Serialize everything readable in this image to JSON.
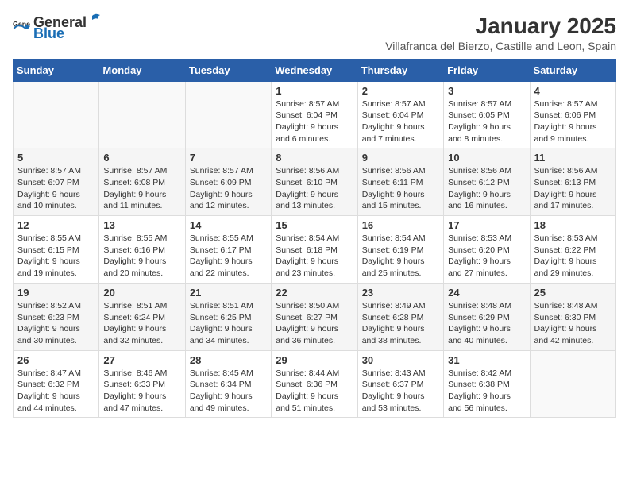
{
  "header": {
    "logo_general": "General",
    "logo_blue": "Blue",
    "month_title": "January 2025",
    "location": "Villafranca del Bierzo, Castille and Leon, Spain"
  },
  "days_of_week": [
    "Sunday",
    "Monday",
    "Tuesday",
    "Wednesday",
    "Thursday",
    "Friday",
    "Saturday"
  ],
  "weeks": [
    {
      "cells": [
        {
          "day": "",
          "content": ""
        },
        {
          "day": "",
          "content": ""
        },
        {
          "day": "",
          "content": ""
        },
        {
          "day": "1",
          "content": "Sunrise: 8:57 AM\nSunset: 6:04 PM\nDaylight: 9 hours and 6 minutes."
        },
        {
          "day": "2",
          "content": "Sunrise: 8:57 AM\nSunset: 6:04 PM\nDaylight: 9 hours and 7 minutes."
        },
        {
          "day": "3",
          "content": "Sunrise: 8:57 AM\nSunset: 6:05 PM\nDaylight: 9 hours and 8 minutes."
        },
        {
          "day": "4",
          "content": "Sunrise: 8:57 AM\nSunset: 6:06 PM\nDaylight: 9 hours and 9 minutes."
        }
      ]
    },
    {
      "cells": [
        {
          "day": "5",
          "content": "Sunrise: 8:57 AM\nSunset: 6:07 PM\nDaylight: 9 hours and 10 minutes."
        },
        {
          "day": "6",
          "content": "Sunrise: 8:57 AM\nSunset: 6:08 PM\nDaylight: 9 hours and 11 minutes."
        },
        {
          "day": "7",
          "content": "Sunrise: 8:57 AM\nSunset: 6:09 PM\nDaylight: 9 hours and 12 minutes."
        },
        {
          "day": "8",
          "content": "Sunrise: 8:56 AM\nSunset: 6:10 PM\nDaylight: 9 hours and 13 minutes."
        },
        {
          "day": "9",
          "content": "Sunrise: 8:56 AM\nSunset: 6:11 PM\nDaylight: 9 hours and 15 minutes."
        },
        {
          "day": "10",
          "content": "Sunrise: 8:56 AM\nSunset: 6:12 PM\nDaylight: 9 hours and 16 minutes."
        },
        {
          "day": "11",
          "content": "Sunrise: 8:56 AM\nSunset: 6:13 PM\nDaylight: 9 hours and 17 minutes."
        }
      ]
    },
    {
      "cells": [
        {
          "day": "12",
          "content": "Sunrise: 8:55 AM\nSunset: 6:15 PM\nDaylight: 9 hours and 19 minutes."
        },
        {
          "day": "13",
          "content": "Sunrise: 8:55 AM\nSunset: 6:16 PM\nDaylight: 9 hours and 20 minutes."
        },
        {
          "day": "14",
          "content": "Sunrise: 8:55 AM\nSunset: 6:17 PM\nDaylight: 9 hours and 22 minutes."
        },
        {
          "day": "15",
          "content": "Sunrise: 8:54 AM\nSunset: 6:18 PM\nDaylight: 9 hours and 23 minutes."
        },
        {
          "day": "16",
          "content": "Sunrise: 8:54 AM\nSunset: 6:19 PM\nDaylight: 9 hours and 25 minutes."
        },
        {
          "day": "17",
          "content": "Sunrise: 8:53 AM\nSunset: 6:20 PM\nDaylight: 9 hours and 27 minutes."
        },
        {
          "day": "18",
          "content": "Sunrise: 8:53 AM\nSunset: 6:22 PM\nDaylight: 9 hours and 29 minutes."
        }
      ]
    },
    {
      "cells": [
        {
          "day": "19",
          "content": "Sunrise: 8:52 AM\nSunset: 6:23 PM\nDaylight: 9 hours and 30 minutes."
        },
        {
          "day": "20",
          "content": "Sunrise: 8:51 AM\nSunset: 6:24 PM\nDaylight: 9 hours and 32 minutes."
        },
        {
          "day": "21",
          "content": "Sunrise: 8:51 AM\nSunset: 6:25 PM\nDaylight: 9 hours and 34 minutes."
        },
        {
          "day": "22",
          "content": "Sunrise: 8:50 AM\nSunset: 6:27 PM\nDaylight: 9 hours and 36 minutes."
        },
        {
          "day": "23",
          "content": "Sunrise: 8:49 AM\nSunset: 6:28 PM\nDaylight: 9 hours and 38 minutes."
        },
        {
          "day": "24",
          "content": "Sunrise: 8:48 AM\nSunset: 6:29 PM\nDaylight: 9 hours and 40 minutes."
        },
        {
          "day": "25",
          "content": "Sunrise: 8:48 AM\nSunset: 6:30 PM\nDaylight: 9 hours and 42 minutes."
        }
      ]
    },
    {
      "cells": [
        {
          "day": "26",
          "content": "Sunrise: 8:47 AM\nSunset: 6:32 PM\nDaylight: 9 hours and 44 minutes."
        },
        {
          "day": "27",
          "content": "Sunrise: 8:46 AM\nSunset: 6:33 PM\nDaylight: 9 hours and 47 minutes."
        },
        {
          "day": "28",
          "content": "Sunrise: 8:45 AM\nSunset: 6:34 PM\nDaylight: 9 hours and 49 minutes."
        },
        {
          "day": "29",
          "content": "Sunrise: 8:44 AM\nSunset: 6:36 PM\nDaylight: 9 hours and 51 minutes."
        },
        {
          "day": "30",
          "content": "Sunrise: 8:43 AM\nSunset: 6:37 PM\nDaylight: 9 hours and 53 minutes."
        },
        {
          "day": "31",
          "content": "Sunrise: 8:42 AM\nSunset: 6:38 PM\nDaylight: 9 hours and 56 minutes."
        },
        {
          "day": "",
          "content": ""
        }
      ]
    }
  ]
}
